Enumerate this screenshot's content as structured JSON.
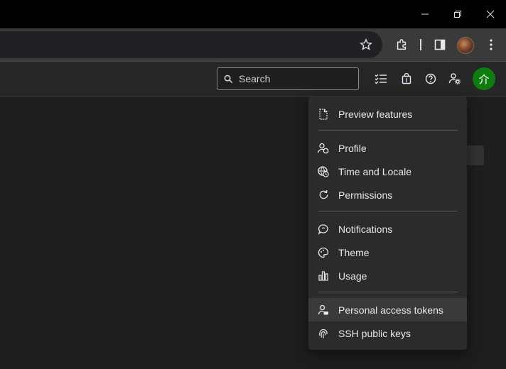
{
  "window_controls": {
    "minimize_icon": "minimize-icon",
    "restore_icon": "restore-icon",
    "close_icon": "close-icon"
  },
  "browser_toolbar": {
    "bookmark_icon": "star-icon",
    "extensions_icon": "puzzle-icon",
    "side_panel_icon": "side-panel-icon",
    "menu_icon": "more-vertical-icon"
  },
  "app_header": {
    "search": {
      "placeholder": "Search"
    },
    "user_initials": "介",
    "accent_color": "#107c10"
  },
  "menu": {
    "groups": [
      {
        "items": [
          {
            "label": "Preview features",
            "icon": "document-icon"
          }
        ]
      },
      {
        "items": [
          {
            "label": "Profile",
            "icon": "profile-icon"
          },
          {
            "label": "Time and Locale",
            "icon": "globe-clock-icon"
          },
          {
            "label": "Permissions",
            "icon": "refresh-icon"
          }
        ]
      },
      {
        "items": [
          {
            "label": "Notifications",
            "icon": "chat-bubble-icon"
          },
          {
            "label": "Theme",
            "icon": "palette-icon"
          },
          {
            "label": "Usage",
            "icon": "bar-chart-icon"
          }
        ]
      },
      {
        "items": [
          {
            "label": "Personal access tokens",
            "icon": "person-key-icon",
            "highlighted": true
          },
          {
            "label": "SSH public keys",
            "icon": "fingerprint-icon"
          }
        ]
      }
    ]
  }
}
